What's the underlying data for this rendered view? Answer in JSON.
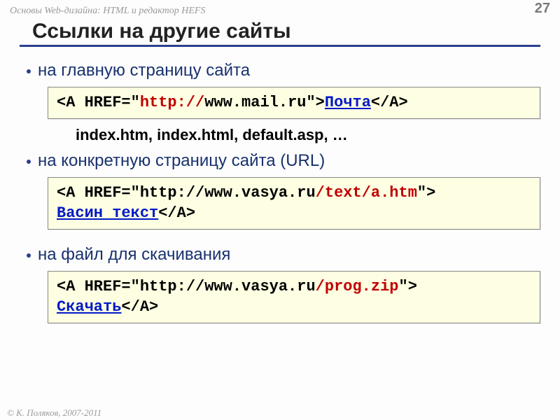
{
  "header": {
    "left": "Основы Web-дизайна: HTML и редактор HEFS",
    "page": "27"
  },
  "title": "Ссылки на другие сайты",
  "bullets": {
    "b1": "на главную страницу сайта",
    "b2": "на конкретную страницу сайта (URL)",
    "b3": "на файл для скачивания"
  },
  "code1": {
    "p1": "<A HREF=\"",
    "p2": "http://",
    "p3": "www.mail.ru\">",
    "p4": "Почта",
    "p5": "</A>"
  },
  "subnote": "index.htm, index.html, default.asp, …",
  "code2": {
    "p1": "<A HREF=\"http://www.vasya.ru",
    "p2": "/text/a.htm",
    "p3": "\">",
    "br": " ",
    "p4": "Васин текст",
    "p5": "</A>"
  },
  "code3": {
    "p1": "<A HREF=\"http://www.vasya.ru",
    "p2": "/prog.zip",
    "p3": "\">",
    "p4": "Скачать",
    "p5": "</A>"
  },
  "footer": "© К. Поляков, 2007-2011"
}
